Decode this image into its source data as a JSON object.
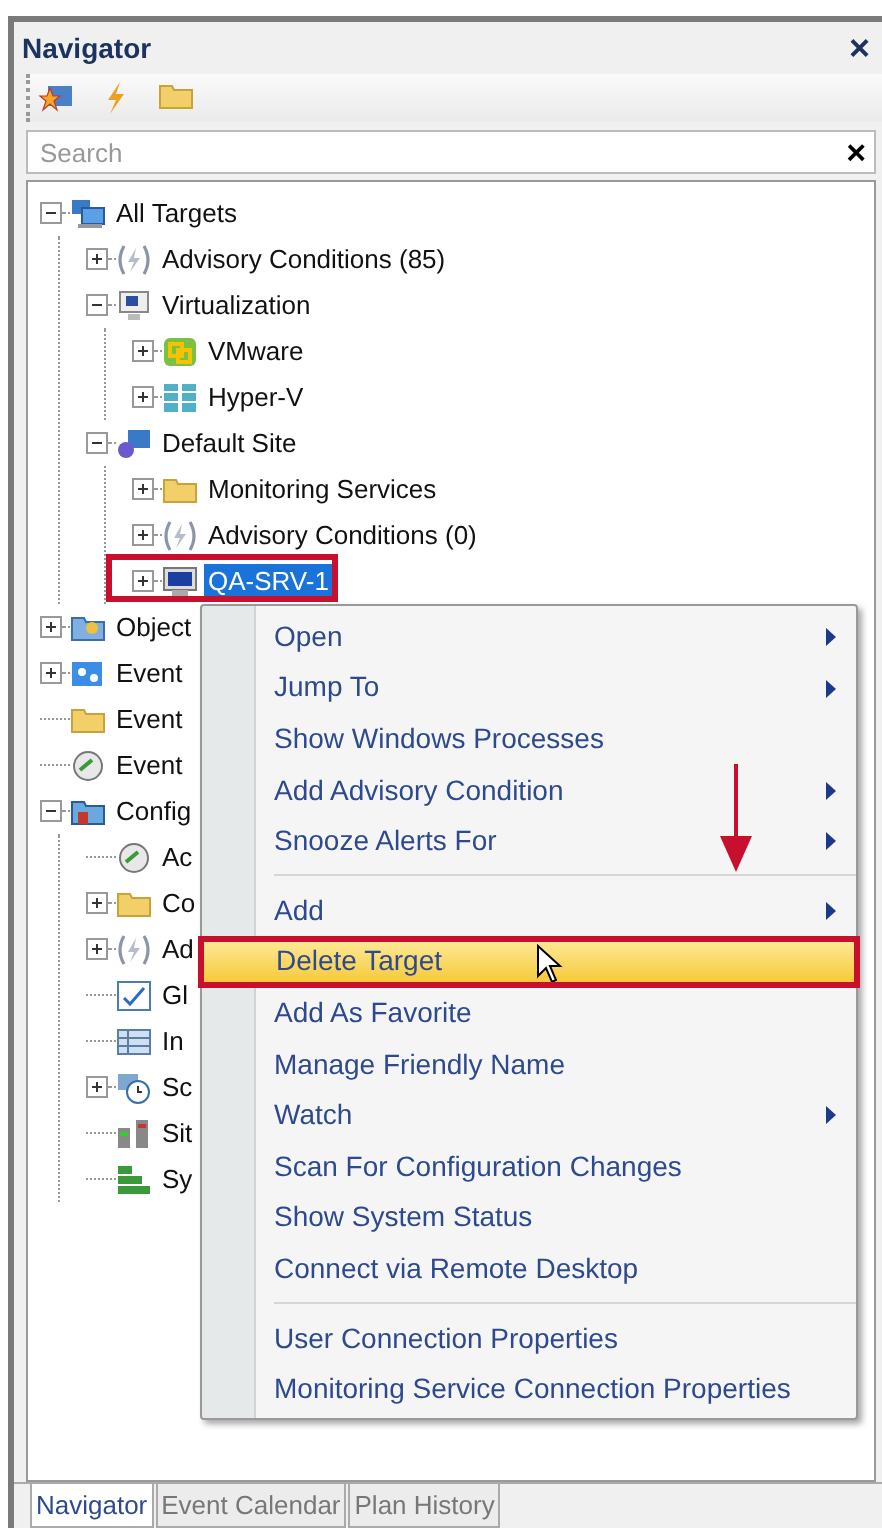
{
  "window": {
    "title": "Navigator",
    "close": "×"
  },
  "search": {
    "placeholder": "Search",
    "clear": "×"
  },
  "tree": [
    {
      "label": "All Targets",
      "kind": "branch",
      "expanded": true,
      "selected": false,
      "children": [
        {
          "label": "Advisory Conditions (85)",
          "kind": "branch",
          "expanded": false,
          "selected": false
        },
        {
          "label": "Virtualization",
          "kind": "branch",
          "expanded": true,
          "selected": false,
          "children": [
            {
              "label": "VMware",
              "kind": "branch",
              "expanded": false,
              "selected": false
            },
            {
              "label": "Hyper-V",
              "kind": "branch",
              "expanded": false,
              "selected": false
            }
          ]
        },
        {
          "label": "Default Site",
          "kind": "branch",
          "expanded": true,
          "selected": false,
          "children": [
            {
              "label": "Monitoring Services",
              "kind": "branch",
              "expanded": false,
              "selected": false
            },
            {
              "label": "Advisory Conditions (0)",
              "kind": "branch",
              "expanded": false,
              "selected": false
            },
            {
              "label": "QA-SRV-1",
              "kind": "branch",
              "expanded": false,
              "selected": true
            }
          ]
        }
      ]
    },
    {
      "label": "Object",
      "kind": "branch",
      "expanded": false,
      "selected": false
    },
    {
      "label": "Event",
      "kind": "branch",
      "expanded": false,
      "selected": false
    },
    {
      "label": "Event",
      "kind": "leaf",
      "selected": false
    },
    {
      "label": "Event",
      "kind": "leaf",
      "selected": false
    },
    {
      "label": "Config",
      "kind": "branch",
      "expanded": true,
      "selected": false,
      "children": [
        {
          "label": "Ac",
          "kind": "leaf",
          "selected": false
        },
        {
          "label": "Co",
          "kind": "branch",
          "expanded": false,
          "selected": false
        },
        {
          "label": "Ad",
          "kind": "branch",
          "expanded": false,
          "selected": false
        },
        {
          "label": "Gl",
          "kind": "leaf",
          "selected": false
        },
        {
          "label": "In",
          "kind": "leaf",
          "selected": false
        },
        {
          "label": "Sc",
          "kind": "branch",
          "expanded": false,
          "selected": false
        },
        {
          "label": "Sit",
          "kind": "leaf",
          "selected": false
        },
        {
          "label": "Sy",
          "kind": "leaf",
          "selected": false
        }
      ]
    }
  ],
  "context_menu": [
    {
      "kind": "item",
      "label": "Open",
      "submenu": true,
      "selected": false
    },
    {
      "kind": "item",
      "label": "Jump To",
      "submenu": true,
      "selected": false
    },
    {
      "kind": "item",
      "label": "Show Windows Processes",
      "submenu": false,
      "selected": false
    },
    {
      "kind": "item",
      "label": "Add Advisory Condition",
      "submenu": true,
      "selected": false
    },
    {
      "kind": "item",
      "label": "Snooze Alerts For",
      "submenu": true,
      "selected": false
    },
    {
      "kind": "separator"
    },
    {
      "kind": "item",
      "label": "Add",
      "submenu": true,
      "selected": false
    },
    {
      "kind": "item",
      "label": "Delete Target",
      "submenu": false,
      "selected": true
    },
    {
      "kind": "item",
      "label": "Add As Favorite",
      "submenu": false,
      "selected": false
    },
    {
      "kind": "item",
      "label": "Manage Friendly Name",
      "submenu": false,
      "selected": false
    },
    {
      "kind": "item",
      "label": "Watch",
      "submenu": true,
      "selected": false
    },
    {
      "kind": "item",
      "label": "Scan For Configuration Changes",
      "submenu": false,
      "selected": false
    },
    {
      "kind": "item",
      "label": "Show System Status",
      "submenu": false,
      "selected": false
    },
    {
      "kind": "item",
      "label": "Connect via Remote Desktop",
      "submenu": false,
      "selected": false
    },
    {
      "kind": "separator"
    },
    {
      "kind": "item",
      "label": "User Connection Properties",
      "submenu": false,
      "selected": false
    },
    {
      "kind": "item",
      "label": "Monitoring Service Connection Properties",
      "submenu": false,
      "selected": false
    }
  ],
  "tabs": [
    {
      "label": "Navigator",
      "selected": true
    },
    {
      "label": "Event Calendar",
      "selected": false
    },
    {
      "label": "Plan History",
      "selected": false
    }
  ]
}
